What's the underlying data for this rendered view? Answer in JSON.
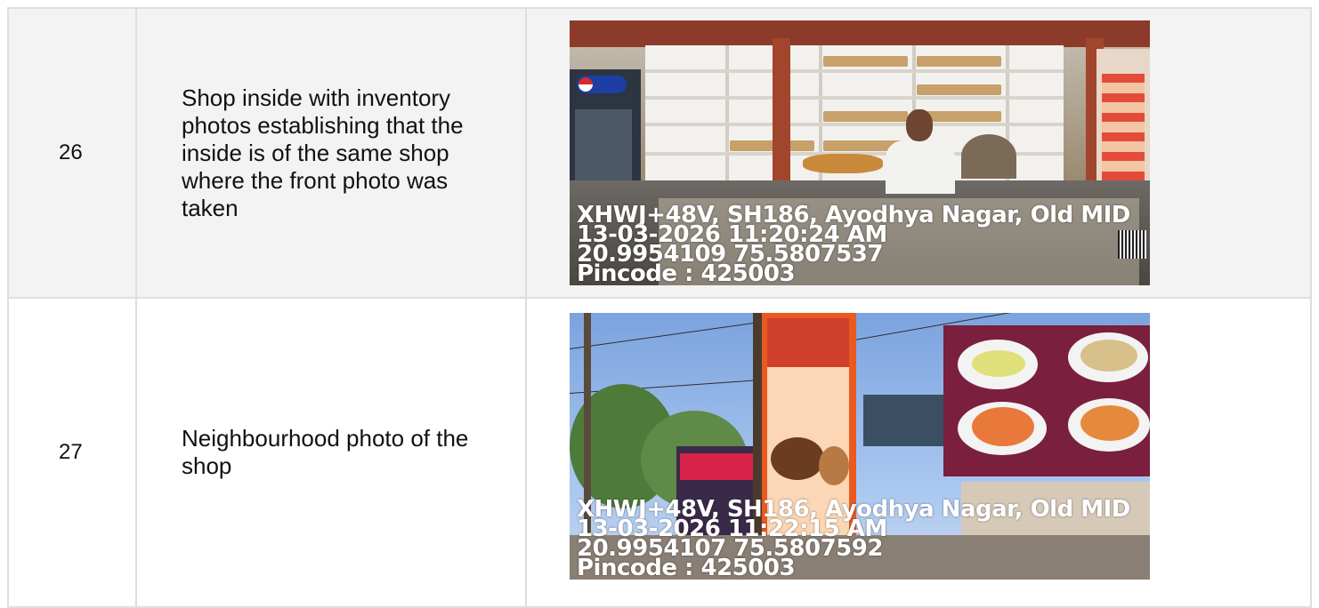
{
  "rows": [
    {
      "number": "26",
      "description": "Shop inside with inventory photos establishing that the inside is of the same shop where the front photo was taken",
      "photo": {
        "subject": "shop-interior",
        "stamp": {
          "address": "XHWJ+48V, SH186, Ayodhya Nagar, Old MID",
          "datetime": "13-03-2026 11:20:24 AM",
          "coords": "20.9954109 75.5807537",
          "pincode": "Pincode : 425003"
        }
      }
    },
    {
      "number": "27",
      "description": "Neighbourhood photo of the shop",
      "photo": {
        "subject": "neighbourhood",
        "stamp": {
          "address": "XHWJ+48V, SH186, Ayodhya Nagar, Old MID",
          "datetime": "13-03-2026 11:22:15 AM",
          "coords": "20.9954107 75.5807592",
          "pincode": "Pincode : 425003"
        }
      }
    }
  ],
  "colors": {
    "border": "#dedede",
    "row_shaded": "#f3f3f3",
    "text": "#111111",
    "stamp_text": "#ffffff"
  }
}
